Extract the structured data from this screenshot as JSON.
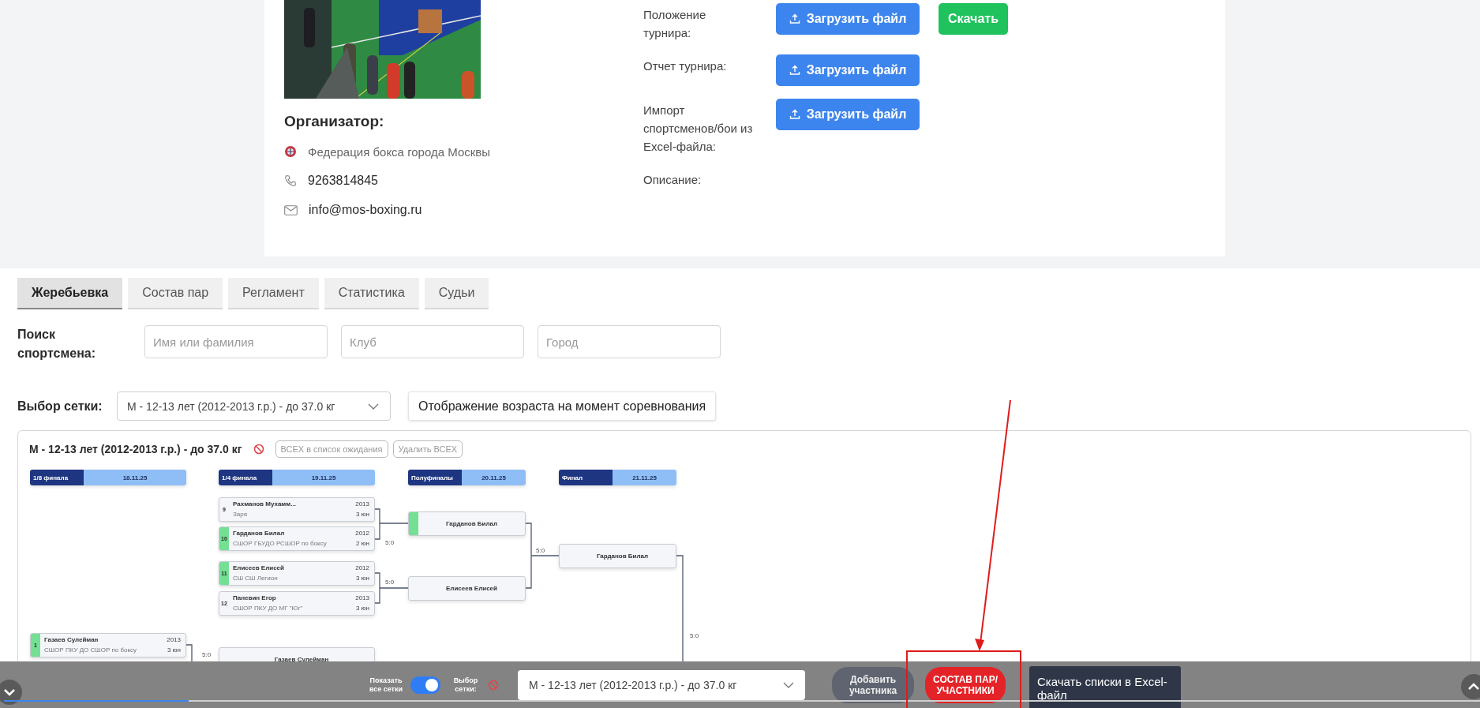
{
  "organizer": {
    "title": "Организатор:",
    "name": "Федерация бокса города Москвы",
    "phone": "9263814845",
    "email": "info@mos-boxing.ru"
  },
  "documents": [
    {
      "label": "Положение турнира:",
      "buttons": [
        {
          "kind": "upload",
          "label": "Загрузить файл"
        },
        {
          "kind": "download",
          "label": "Скачать"
        }
      ]
    },
    {
      "label": "Отчет турнира:",
      "buttons": [
        {
          "kind": "upload",
          "label": "Загрузить файл"
        }
      ]
    },
    {
      "label": "Импорт спортсменов/бои из Excel-файла:",
      "buttons": [
        {
          "kind": "upload",
          "label": "Загрузить файл"
        }
      ]
    },
    {
      "label": "Описание:"
    }
  ],
  "tabs": [
    {
      "label": "Жеребьевка",
      "selected": true
    },
    {
      "label": "Состав пар",
      "selected": false
    },
    {
      "label": "Регламент",
      "selected": false
    },
    {
      "label": "Статистика",
      "selected": false
    },
    {
      "label": "Судьи",
      "selected": false
    }
  ],
  "search": {
    "label": "Поиск спортсмена:",
    "fields": [
      {
        "placeholder": "Имя или фамилия"
      },
      {
        "placeholder": "Клуб"
      },
      {
        "placeholder": "Город"
      }
    ]
  },
  "grid_select": {
    "label": "Выбор сетки:",
    "value": "М - 12-13 лет (2012-2013 г.р.) - до 37.0 кг",
    "age_button": "Отображение возраста на момент соревнования"
  },
  "bracket": {
    "title": "М - 12-13 лет (2012-2013 г.р.) - до 37.0 кг",
    "actions": [
      "ВСЕХ в список ожидания",
      "Удалить ВСЕХ"
    ],
    "rounds": [
      {
        "label": "1/8 финала",
        "date": "18.11.25",
        "cards": [
          {
            "kind": "player",
            "seed": "1",
            "name": "Газаев Сулейман",
            "club": "СШОР ПКУ ДО СШОР по боксу",
            "year": "2013",
            "rank": "3 юн",
            "winner": true
          }
        ]
      },
      {
        "label": "1/4 финала",
        "date": "19.11.25",
        "cards": [
          {
            "kind": "player",
            "seed": "9",
            "name": "Рахманов Мухамм...",
            "club": "Заря",
            "year": "2013",
            "rank": "3 юн",
            "winner": false
          },
          {
            "kind": "player",
            "seed": "10",
            "name": "Гарданов Билал",
            "club": "СШОР ГБУДО РСШОР по боксу",
            "year": "2012",
            "rank": "2 юн",
            "winner": true
          },
          {
            "kind": "player",
            "seed": "11",
            "name": "Елисеев Елисей",
            "club": "СШ СШ Легион",
            "year": "2012",
            "rank": "3 юн",
            "winner": true
          },
          {
            "kind": "player",
            "seed": "12",
            "name": "Паневин Егор",
            "club": "СШОР ПКУ ДО МГ \"Юг\"",
            "year": "2013",
            "rank": "3 юн",
            "winner": false
          },
          {
            "kind": "name",
            "name": "Газаев Сулейман",
            "winner": false
          }
        ]
      },
      {
        "label": "Полуфиналы",
        "date": "20.11.25",
        "cards": [
          {
            "kind": "name",
            "name": "Гарданов Билал",
            "winner": true
          },
          {
            "kind": "name",
            "name": "Елисеев Елисей",
            "winner": false
          }
        ]
      },
      {
        "label": "Финал",
        "date": "21.11.25",
        "cards": [
          {
            "kind": "name",
            "name": "Гарданов Билал",
            "winner": false
          }
        ]
      }
    ],
    "scores": [
      "5:0",
      "5:0",
      "5:0",
      "5:0",
      "5:0"
    ]
  },
  "player_bar": {
    "progress": {
      "level": 0.125
    },
    "toggle": {
      "label": "Показать все сетки",
      "on": true
    },
    "select_label": "Выбор сетки:",
    "select_value": "М - 12-13 лет (2012-2013 г.р.) - до 37.0 кг",
    "buttons": [
      {
        "kind": "secondary",
        "label": "Добавить участника"
      },
      {
        "kind": "primary",
        "label": "СОСТАВ ПАР/ УЧАСТНИКИ"
      },
      {
        "kind": "dark",
        "label": "Скачать списки в Excel-файл"
      }
    ]
  }
}
